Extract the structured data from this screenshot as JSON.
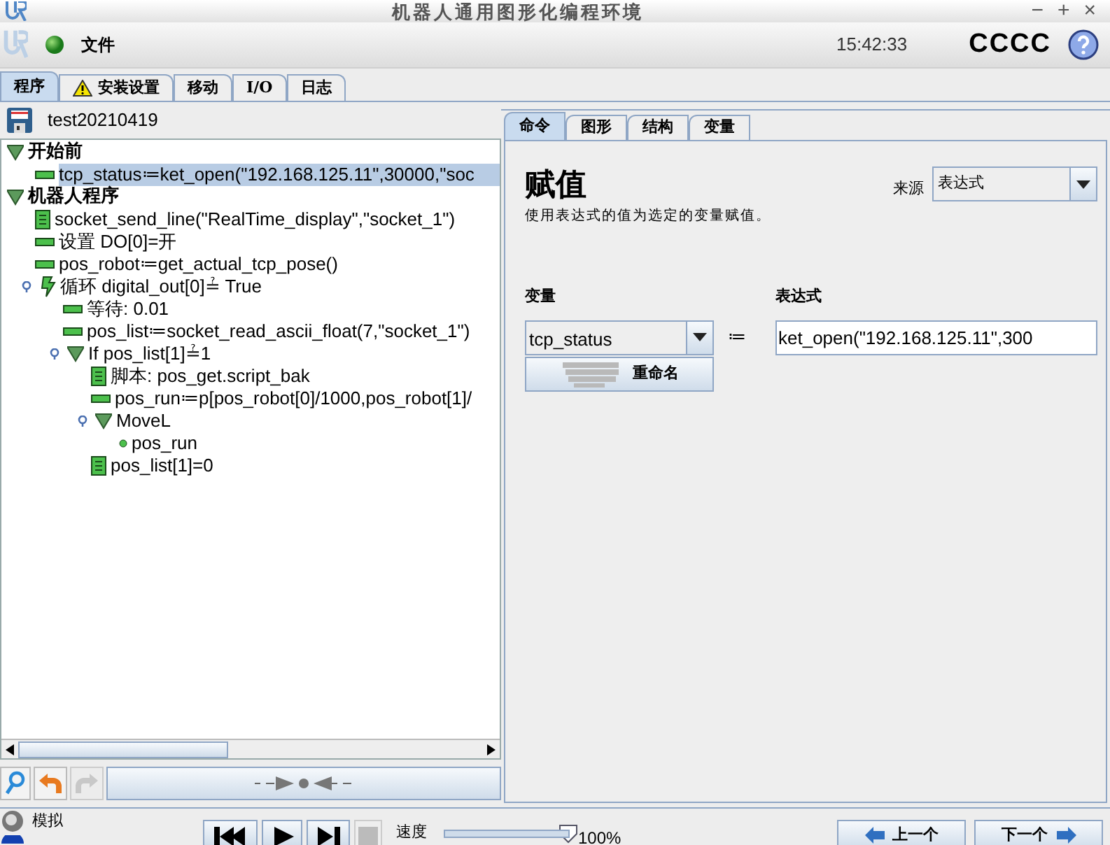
{
  "window": {
    "title": "机器人通用图形化编程环境",
    "controls": [
      "−",
      "+",
      "×"
    ]
  },
  "toolbar": {
    "menu": "文件",
    "time": "15:42:33",
    "robot_name": "CCCC"
  },
  "main_tabs": [
    {
      "label": "程序",
      "selected": true,
      "warning": false
    },
    {
      "label": "安装设置",
      "selected": false,
      "warning": true
    },
    {
      "label": "移动",
      "selected": false,
      "warning": false
    },
    {
      "label": "I/O",
      "selected": false,
      "warning": false
    },
    {
      "label": "日志",
      "selected": false,
      "warning": false
    }
  ],
  "program": {
    "name": "test20210419",
    "tree": [
      {
        "label": "开始前",
        "kind": "folder",
        "bold": true,
        "selected": false,
        "expanded": true,
        "children": [
          {
            "label": "tcp_status≔ket_open(\"192.168.125.11\",30000,\"soc",
            "kind": "assign",
            "selected": true
          }
        ]
      },
      {
        "label": "机器人程序",
        "kind": "folder",
        "bold": true,
        "selected": false,
        "expanded": true,
        "children": [
          {
            "label": "socket_send_line(\"RealTime_display\",\"socket_1\")",
            "kind": "script",
            "selected": false
          },
          {
            "label": "设置 DO[0]=开",
            "kind": "assign",
            "selected": false
          },
          {
            "label": "pos_robot≔get_actual_tcp_pose()",
            "kind": "assign",
            "selected": false
          },
          {
            "label": "循环 digital_out[0]≟ True",
            "kind": "loop",
            "selected": false,
            "expanded": true,
            "children": [
              {
                "label": "等待: 0.01",
                "kind": "assign",
                "selected": false
              },
              {
                "label": "pos_list≔socket_read_ascii_float(7,\"socket_1\")",
                "kind": "assign",
                "selected": false
              },
              {
                "label": "If pos_list[1]≟1",
                "kind": "folder",
                "selected": false,
                "expanded": true,
                "children": [
                  {
                    "label": "脚本: pos_get.script_bak",
                    "kind": "script",
                    "selected": false
                  },
                  {
                    "label": "pos_run≔p[pos_robot[0]/1000,pos_robot[1]/",
                    "kind": "assign",
                    "selected": false
                  },
                  {
                    "label": "MoveL",
                    "kind": "folder",
                    "selected": false,
                    "expanded": true,
                    "children": [
                      {
                        "label": "pos_run",
                        "kind": "waypoint",
                        "selected": false
                      }
                    ]
                  },
                  {
                    "label": "pos_list[1]=0",
                    "kind": "script",
                    "selected": false
                  }
                ]
              }
            ]
          }
        ]
      }
    ]
  },
  "side_tabs": [
    {
      "label": "命令",
      "selected": true
    },
    {
      "label": "图形",
      "selected": false
    },
    {
      "label": "结构",
      "selected": false
    },
    {
      "label": "变量",
      "selected": false
    }
  ],
  "command": {
    "title": "赋值",
    "description": "使用表达式的值为选定的变量赋值。",
    "source_label": "来源",
    "source_value": "表达式",
    "variable_label": "变量",
    "variable_value": "tcp_status",
    "assign_sign": "≔",
    "rename_button": "重命名",
    "expression_label": "表达式",
    "expression_value": "ket_open(\"192.168.125.11\",300"
  },
  "bottom": {
    "simulation": {
      "label": "模拟",
      "selected": false
    },
    "real_robot": {
      "selected": true
    },
    "speed_label": "速度",
    "speed": {
      "level": 1.0
    },
    "speed_reading": "100%",
    "prev_button": "上一个",
    "next_button": "下一个"
  }
}
